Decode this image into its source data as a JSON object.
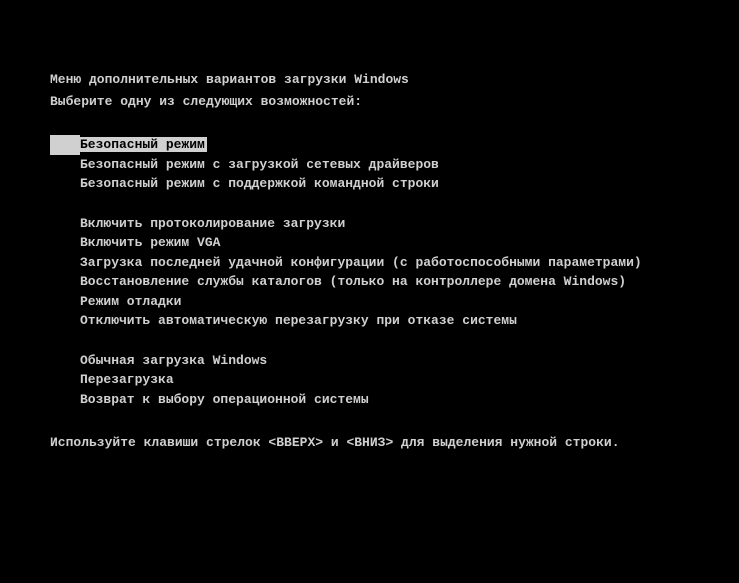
{
  "title": "Меню дополнительных вариантов загрузки Windows",
  "subtitle": "Выберите одну из следующих возможностей:",
  "groups": [
    {
      "items": [
        {
          "label": "Безопасный режим",
          "selected": true
        },
        {
          "label": "Безопасный режим с загрузкой сетевых драйверов",
          "selected": false
        },
        {
          "label": "Безопасный режим с поддержкой командной строки",
          "selected": false
        }
      ]
    },
    {
      "items": [
        {
          "label": "Включить протоколирование загрузки",
          "selected": false
        },
        {
          "label": "Включить режим VGA",
          "selected": false
        },
        {
          "label": "Загрузка последней удачной конфигурации (с работоспособными параметрами)",
          "selected": false
        },
        {
          "label": "Восстановление службы каталогов (только на контроллере домена Windows)",
          "selected": false
        },
        {
          "label": "Режим отладки",
          "selected": false
        },
        {
          "label": "Отключить автоматическую перезагрузку при отказе системы",
          "selected": false
        }
      ]
    },
    {
      "items": [
        {
          "label": "Обычная загрузка Windows",
          "selected": false
        },
        {
          "label": "Перезагрузка",
          "selected": false
        },
        {
          "label": "Возврат к выбору операционной системы",
          "selected": false
        }
      ]
    }
  ],
  "footer": "Используйте клавиши стрелок <ВВЕРХ> и <ВНИЗ> для выделения нужной строки."
}
